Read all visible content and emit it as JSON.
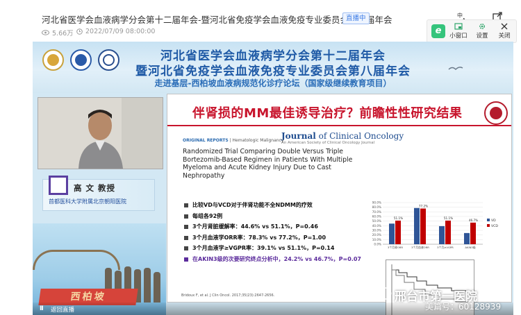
{
  "header": {
    "title": "河北省医学会血液病学分会第十二届年会-暨河北省免疫学会血液免疫专业委员会第八届年会",
    "live_badge": "直播中",
    "views": "5.66万",
    "date": "2022/07/09 08:00:00",
    "icons": [
      "translate-icon",
      "share-icon"
    ]
  },
  "popup": {
    "logo_letter": "e",
    "buttons": [
      {
        "label": "小窗口",
        "icon": "mini-window-icon"
      },
      {
        "label": "设置",
        "icon": "gear-icon"
      },
      {
        "label": "关闭",
        "icon": "close-icon"
      }
    ]
  },
  "video": {
    "banner": {
      "line1": "河北省医学会血液病学分会第十二届年会",
      "line2": "暨河北省免疫学会血液免疫专业委员会第八届年会",
      "line3": "走进基层-西柏坡血液病规范化诊疗论坛（国家级继续教育项目）"
    },
    "speaker": {
      "name": "高 文 教授",
      "affiliation": "首都医科大学附属北京朝阳医院"
    },
    "scene_sign": "西柏坡",
    "controls": {
      "play_glyph": "II",
      "back_live": "返回直播"
    }
  },
  "slide": {
    "title": "伴肾损的MM最佳诱导治疗？前瞻性性研究结果",
    "journal": {
      "prefix": "Journal",
      "of": "of",
      "name": "Clinical Oncology",
      "sub": "An American Society of Clinical Oncology Journal"
    },
    "report_tag": "ORIGINAL REPORTS",
    "report_topic": "Hematologic Malignancy",
    "paper_title": "Randomized Trial Comparing Double Versus Triple Bortezomib-Based Regimen in Patients With Multiple Myeloma and Acute Kidney Injury Due to Cast Nephropathy",
    "bullets": [
      "比较VD与VCD对于伴肾功能不全NDMM的疗效",
      "每组各92例",
      "3个月肾脏缓解率：44.6% vs 51.1%，P=0.46",
      "3个月血液学ORR率：78.3% vs 77.2%，P=1.00",
      "3个月血液学≥VGPR率：39.1% vs 51.1%，P=0.14"
    ],
    "highlight_bullet": "在AKIN3级的次要研究终点分析中，24.2% vs 46.7%，P=0.07",
    "citation": "Bridoux F, et al. J Clin Oncol. 2017;35(23):2647-2656."
  },
  "chart_data": {
    "type": "bar",
    "categories": [
      "3个月肾ORR",
      "3个月血液ORR",
      "3个月≥VGPR",
      "AKIN3级"
    ],
    "series": [
      {
        "name": "VD",
        "values": [
          44.6,
          78.3,
          39.1,
          24.2
        ],
        "color": "#2f5597"
      },
      {
        "name": "VCD",
        "values": [
          51.1,
          77.2,
          51.1,
          46.7
        ],
        "color": "#c00000"
      }
    ],
    "data_labels": [
      "51.1%",
      "77.2%",
      "51.1%",
      "46.7%"
    ],
    "ylim": [
      0,
      90
    ],
    "yticks": [
      "0.0%",
      "10.0%",
      "20.0%",
      "30.0%",
      "40.0%",
      "50.0%",
      "60.0%",
      "70.0%",
      "80.0%",
      "90.0%"
    ],
    "legend": "right"
  },
  "watermark": {
    "text": "邢台市第一医院",
    "sub": "美篇号：60128939"
  },
  "colors": {
    "slide_title": "#c8142c",
    "banner_text": "#1f5aa6",
    "highlight": "#5b2b9c",
    "popup_logo": "#35c47c"
  }
}
